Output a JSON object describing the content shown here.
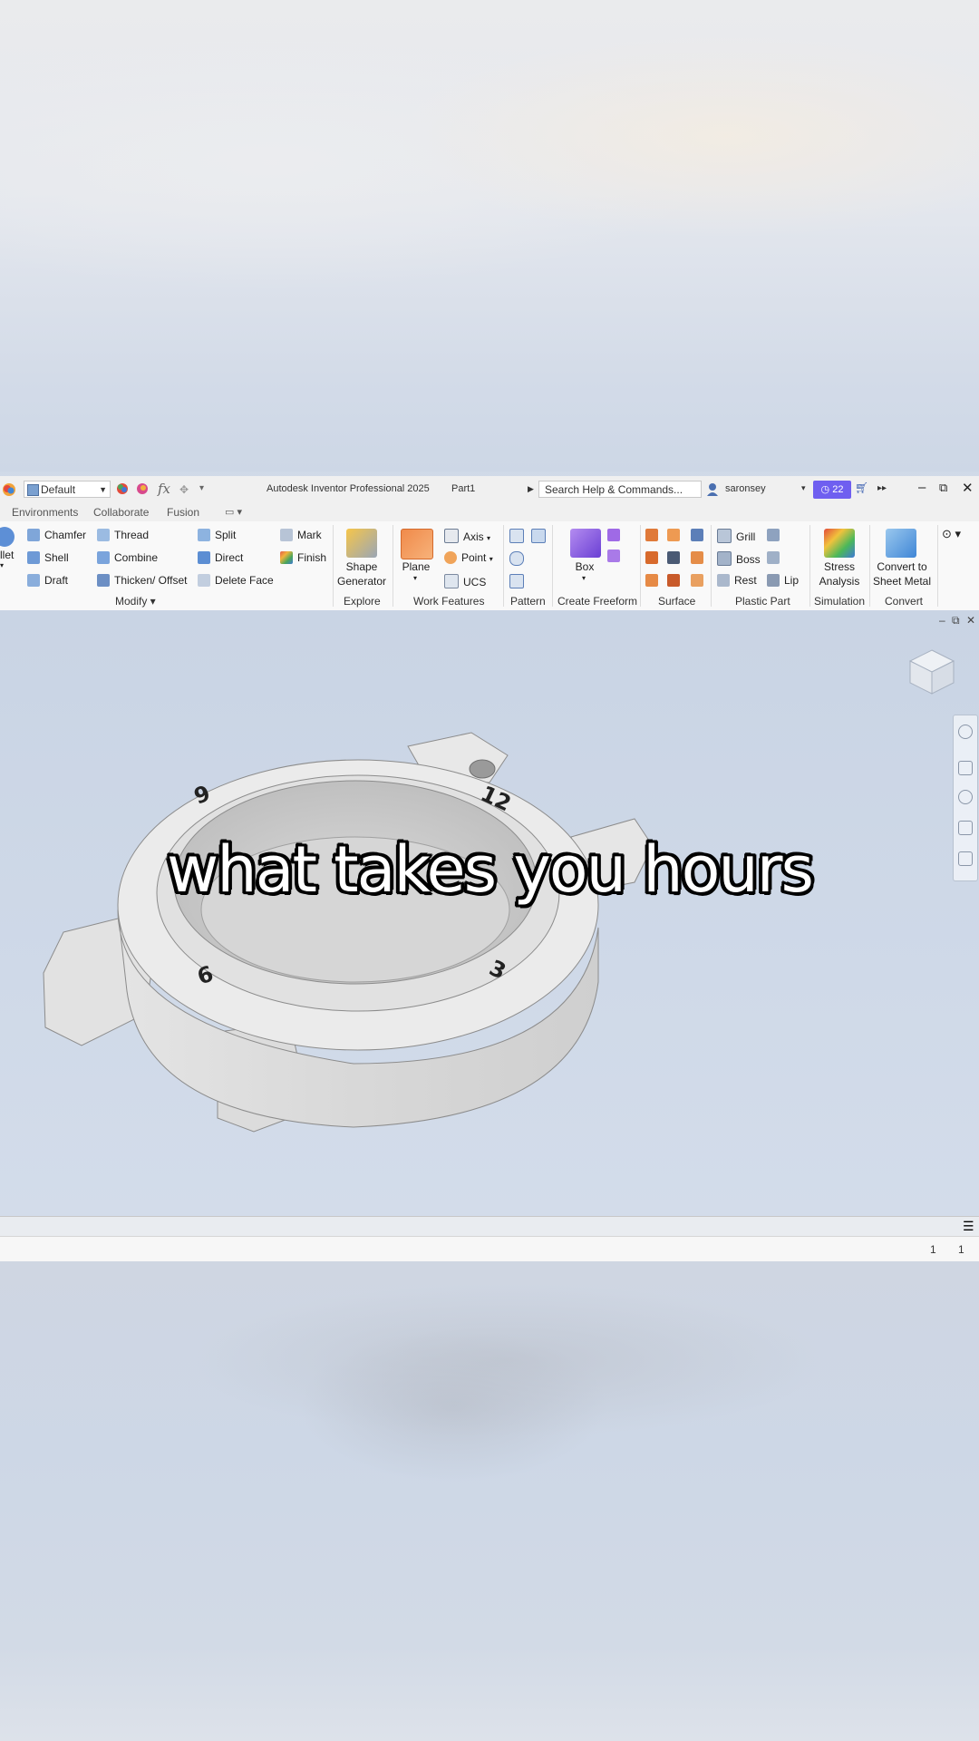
{
  "app": {
    "title": "Autodesk Inventor Professional 2025",
    "document": "Part1",
    "appearance_combo": "Default",
    "search_placeholder": "Search Help & Commands...",
    "user": "saronsey",
    "notification_count": "22"
  },
  "tabs": [
    "Environments",
    "Collaborate",
    "Fusion"
  ],
  "ribbon": {
    "modify": {
      "items": [
        "Chamfer",
        "Thread",
        "Split",
        "Mark",
        "Shell",
        "Combine",
        "Direct",
        "Finish",
        "Draft",
        "Thicken/ Offset",
        "Delete Face"
      ],
      "cut_item": "llet",
      "label": "Modify"
    },
    "explore": {
      "button": "Shape\nGenerator",
      "label": "Explore"
    },
    "work_features": {
      "plane": "Plane",
      "axis": "Axis",
      "point": "Point",
      "ucs": "UCS",
      "label": "Work Features"
    },
    "pattern": {
      "label": "Pattern"
    },
    "create_freeform": {
      "button": "Box",
      "label": "Create Freeform"
    },
    "surface": {
      "label": "Surface"
    },
    "plastic_part": {
      "grill": "Grill",
      "boss": "Boss",
      "rest": "Rest",
      "lip": "Lip",
      "label": "Plastic Part"
    },
    "simulation": {
      "button": "Stress\nAnalysis",
      "label": "Simulation"
    },
    "convert": {
      "button": "Convert to\nSheet Metal",
      "label": "Convert"
    }
  },
  "model": {
    "bezel_numbers": [
      "9",
      "12",
      "6",
      "3"
    ]
  },
  "caption": "what takes you hours",
  "status": {
    "left_count": "1",
    "right_count": "1"
  },
  "colors": {
    "accent": "#6f5ff0",
    "viewport": "#cdd7e6",
    "caption_text": "#ffffff",
    "caption_stroke": "#000000"
  }
}
